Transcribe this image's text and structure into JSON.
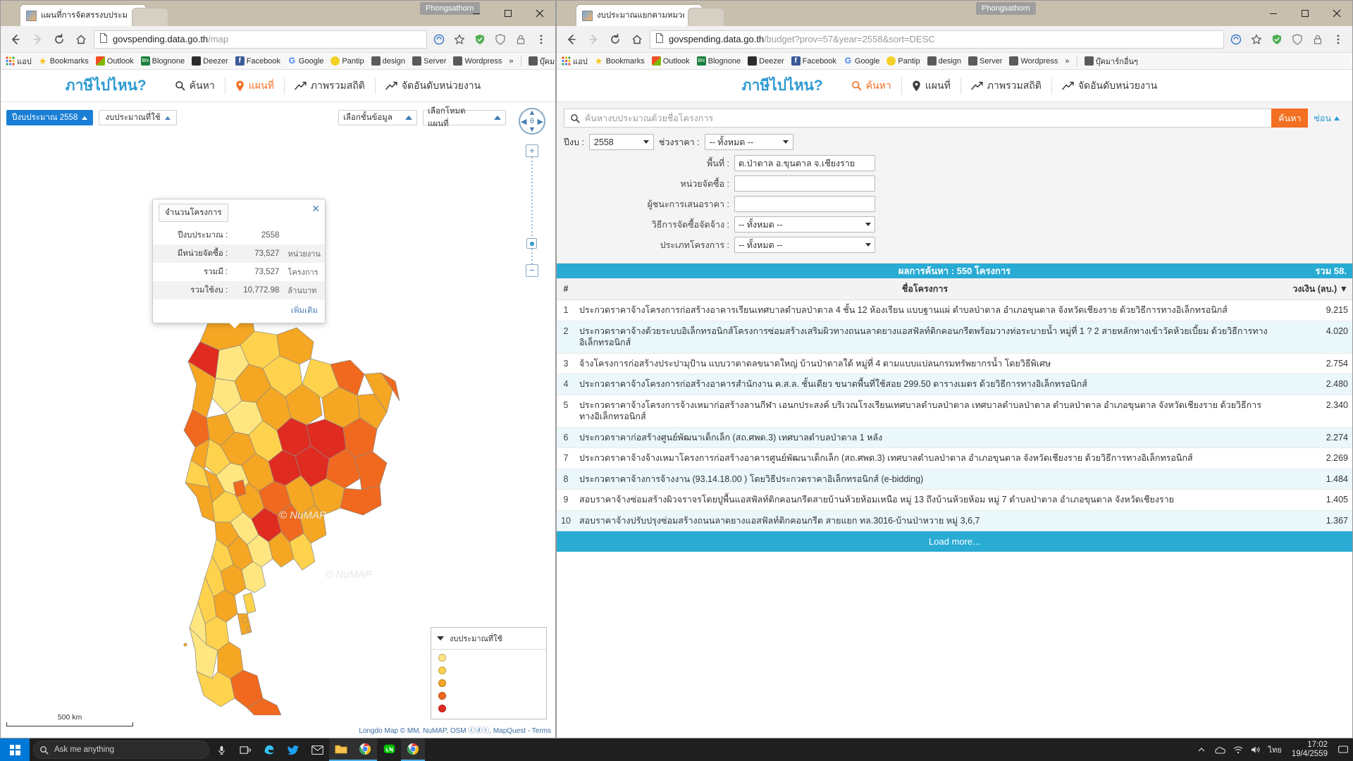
{
  "desktop": {
    "taskbar": {
      "cortana_placeholder": "Ask me anything",
      "clock_time": "17:02",
      "clock_date": "19/4/2559",
      "lang": "ไทย",
      "apps": [
        {
          "name": "task-view-icon",
          "glyph": "▭"
        },
        {
          "name": "edge-icon",
          "glyph": "e"
        },
        {
          "name": "twitter-icon",
          "glyph": "ᵗ"
        },
        {
          "name": "mail-icon",
          "glyph": "✉"
        },
        {
          "name": "file-explorer-icon",
          "glyph": "Ὄ1"
        },
        {
          "name": "chrome-icon",
          "glyph": "◉"
        },
        {
          "name": "line-icon",
          "glyph": "L"
        },
        {
          "name": "chrome2-icon",
          "glyph": "◉"
        }
      ]
    }
  },
  "windows": {
    "left": {
      "user_pill": "Phongsathorn",
      "tab_title": "แผนที่การจัดสรรงบประมาณ",
      "url_main": "govspending.data.go.th",
      "url_path": "/map",
      "controls": {
        "minimize": "—",
        "maximize": "□",
        "close": "✕"
      }
    },
    "right": {
      "user_pill": "Phongsathorn",
      "tab_title": "งบประมาณแยกตามหมวดหมู่",
      "url_main": "govspending.data.go.th",
      "url_path": "/budget?prov=57&year=2558&sort=DESC",
      "controls": {
        "minimize": "—",
        "maximize": "□",
        "close": "✕"
      }
    }
  },
  "bookmarks": [
    {
      "label": "แอป",
      "icon": "apps-grid-icon",
      "color": "#e8453c"
    },
    {
      "label": "Bookmarks",
      "icon": "star-icon",
      "color": "#f5c518"
    },
    {
      "label": "Outlook",
      "icon": "outlook-icon",
      "color": "#0072c6"
    },
    {
      "label": "Blognone",
      "icon": "blognone-icon",
      "color": "#1b7e3b"
    },
    {
      "label": "Deezer",
      "icon": "deezer-icon",
      "color": "#2b2b2b"
    },
    {
      "label": "Facebook",
      "icon": "facebook-icon",
      "color": "#3b5998"
    },
    {
      "label": "Google",
      "icon": "google-icon",
      "color": "#4285f4"
    },
    {
      "label": "Pantip",
      "icon": "pantip-icon",
      "color": "#f2d024"
    },
    {
      "label": "design",
      "icon": "folder-icon",
      "color": "#5a5a5a"
    },
    {
      "label": "Server",
      "icon": "folder-icon",
      "color": "#5a5a5a"
    },
    {
      "label": "Wordpress",
      "icon": "folder-icon",
      "color": "#5a5a5a"
    }
  ],
  "bookmarks_overflow": "»",
  "bookmarks_last": {
    "label": "บุ๊คมาร์กอื่นๆ",
    "icon": "folder-icon"
  },
  "site": {
    "brand": "ภาษีไปไหน?",
    "nav": [
      {
        "label": "ค้นหา",
        "icon": "search-icon"
      },
      {
        "label": "แผนที่",
        "icon": "map-pin-icon"
      },
      {
        "label": "ภาพรวมสถิติ",
        "icon": "chart-line-icon"
      },
      {
        "label": "จัดอันดับหน่วยงาน",
        "icon": "chart-rank-icon"
      }
    ],
    "active_nav_left": "แผนที่",
    "active_nav_right": "ค้นหา"
  },
  "map": {
    "controls": {
      "fiscal_year": "ปีงบประมาณ 2558",
      "budget_used": "งบประมาณที่ใช้",
      "layer_select": "เลือกชั้นข้อมูล",
      "mode_select": "เลือกโหมดแผนที่"
    },
    "zoom_level": "6",
    "popup": {
      "tab_label": "จำนวนโครงการ",
      "close_icon": "close-icon",
      "rows": [
        {
          "key": "ปีงบประมาณ :",
          "value": "2558",
          "unit": ""
        },
        {
          "key": "มีหน่วยจัดซื้อ :",
          "value": "73,527",
          "unit": "หน่วยงาน"
        },
        {
          "key": "รวมมี :",
          "value": "73,527",
          "unit": "โครงการ"
        },
        {
          "key": "รวมใช้งบ :",
          "value": "10,772.98",
          "unit": "ล้านบาท"
        }
      ],
      "more_link": "เพิ่มเติม"
    },
    "legend": {
      "title": "งบประมาณที่ใช้",
      "items": [
        {
          "color": "#ffe680",
          "label": ""
        },
        {
          "color": "#ffd24d",
          "label": ""
        },
        {
          "color": "#f5a623",
          "label": ""
        },
        {
          "color": "#f0691e",
          "label": ""
        },
        {
          "color": "#e02b20",
          "label": ""
        }
      ]
    },
    "scale_label": "500 km",
    "attribution": "Longdo Map © MM, NuMAP, OSM ⓒⓓⓒ, MapQuest - Terms",
    "watermark": "© NuMAP"
  },
  "search_page": {
    "search_placeholder": "ค้นหางบประมาณด้วยชื่อโครงการ",
    "search_button": "ค้นหา",
    "hide_button": "ซ่อน",
    "year_label": "ปีงบ :",
    "year_value": "2558",
    "price_label": "ช่วงราคา :",
    "price_value": "-- ทั้งหมด --",
    "fields": [
      {
        "label": "พื้นที่ :",
        "value": "ต.ป่าตาล อ.ขุนตาล จ.เชียงราย",
        "type": "text"
      },
      {
        "label": "หน่วยจัดซื้อ :",
        "value": "",
        "type": "text"
      },
      {
        "label": "ผู้ชนะการเสนอราคา :",
        "value": "",
        "type": "text"
      },
      {
        "label": "วิธีการจัดซื้อจัดจ้าง :",
        "value": "-- ทั้งหมด --",
        "type": "select"
      },
      {
        "label": "ประเภทโครงการ :",
        "value": "-- ทั้งหมด --",
        "type": "select"
      }
    ],
    "results_title": "ผลการค้นหา : 550 โครงการ",
    "results_total": "รวม 58.",
    "columns": [
      "#",
      "ชื่อโครงการ",
      "วงเงิน (ลบ.) ▼"
    ],
    "rows": [
      {
        "n": "1",
        "name": "ประกวดราคาจ้างโครงการก่อสร้างอาคารเรียนเทศบาลตำบลป่าตาล 4 ชั้น 12 ห้องเรียน แบบฐานแผ่ ตำบลป่าตาล อำเภอขุนตาล จังหวัดเชียงราย ด้วยวิธีการทางอิเล็กทรอนิกส์",
        "amount": "9.215"
      },
      {
        "n": "2",
        "name": "ประกวดราคาจ้างด้วยระบบอิเล็กทรอนิกส์โครงการซ่อมสร้างเสริมผิวทางถนนลาดยางแอสฟัลท์ติกคอนกรีตพร้อมวางท่อระบายน้ำ หมู่ที่ 1 ? 2 สายหลักทางเข้าวัดห้วยเบี้ยม ด้วยวิธีการทางอิเล็กทรอนิกส์",
        "amount": "4.020"
      },
      {
        "n": "3",
        "name": "จ้างโครงการก่อสร้างประปามุป้าน แบบวาตาดลขนาดใหญ่ บ้านป่าตาลใต้ หมู่ที่ 4 ตามแบบแปลนกรมทรัพยากรน้ำ โดยวิธีพิเศษ",
        "amount": "2.754"
      },
      {
        "n": "4",
        "name": "ประกวดราคาจ้างโครงการก่อสร้างอาคารสำนักงาน ค.ส.ล. ชั้นเดียว ขนาดพื้นที่ใช้สอย 299.50 ตารางเมตร ด้วยวิธีการทางอิเล็กทรอนิกส์",
        "amount": "2.480"
      },
      {
        "n": "5",
        "name": "ประกวดราคาจ้างโครงการจ้างเหมาก่อสร้างลานกีฬา เอนกประสงค์ บริเวณโรงเรียนเทศบาลตำบลป่าตาล เทศบาลตำบลป่าตาล ตำบลป่าตาล อำเภอขุนตาล จังหวัดเชียงราย ด้วยวิธีการทางอิเล็กทรอนิกส์",
        "amount": "2.340"
      },
      {
        "n": "6",
        "name": "ประกวดราคาก่อสร้างศูนย์พัฒนาเด็กเล็ก (สถ.ศพด.3) เทศบาลตำบลป่าตาล 1 หลัง",
        "amount": "2.274"
      },
      {
        "n": "7",
        "name": "ประกวดราคาจ้างจ้างเหมาโครงการก่อสร้างอาคารศูนย์พัฒนาเด็กเล็ก (สถ.ศพด.3) เทศบาลตำบลป่าตาล อำเภอขุนตาล จังหวัดเชียงราย ด้วยวิธีการทางอิเล็กทรอนิกส์",
        "amount": "2.269"
      },
      {
        "n": "8",
        "name": "ประกวดราคาจ้างการจ้างงาน (93.14.18.00 ) โดยวิธีประกวดราคาอิเล็กทรอนิกส์ (e-bidding)",
        "amount": "1.484"
      },
      {
        "n": "9",
        "name": "สอบราคาจ้างซ่อมสร้างผิวจราจรโดยปูพื้นแอสฟัลท์ติกคอนกรีตสายบ้านห้วยห้อมเหนือ หมู่ 13 ถึงบ้านห้วยห้อม หมู่ 7 ตำบลป่าตาล อำเภอขุนตาล จังหวัดเชียงราย",
        "amount": "1.405"
      },
      {
        "n": "10",
        "name": "สอบราคาจ้างปรับปรุงซ่อมสร้างถนนลาดยางแอสฟัลท์ติกคอนกรีต สายแยก ทล.3016-บ้านป่าหวาย หมู่ 3,6,7",
        "amount": "1.367"
      }
    ],
    "load_more": "Load more..."
  }
}
